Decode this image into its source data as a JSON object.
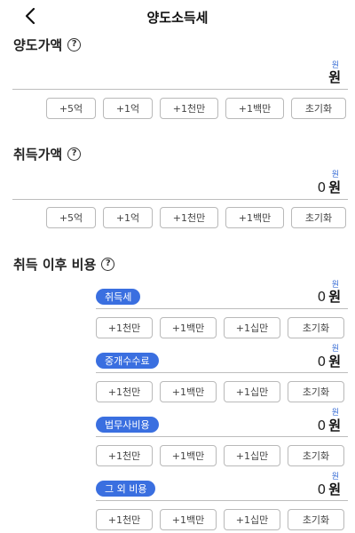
{
  "header": {
    "title": "양도소득세"
  },
  "sale": {
    "title": "양도가액",
    "help": "?",
    "unit_small": "원",
    "amount": "",
    "unit": "원",
    "buttons": [
      "+5억",
      "+1억",
      "+1천만",
      "+1백만",
      "초기화"
    ]
  },
  "acquisition": {
    "title": "취득가액",
    "help": "?",
    "unit_small": "원",
    "amount": "0",
    "unit": "원",
    "buttons": [
      "+5억",
      "+1억",
      "+1천만",
      "+1백만",
      "초기화"
    ]
  },
  "post_costs": {
    "title": "취득 이후 비용",
    "help": "?",
    "items": [
      {
        "label": "취득세",
        "unit_small": "원",
        "amount": "0",
        "unit": "원",
        "buttons": [
          "+1천만",
          "+1백만",
          "+1십만",
          "초기화"
        ]
      },
      {
        "label": "중개수수료",
        "unit_small": "원",
        "amount": "0",
        "unit": "원",
        "buttons": [
          "+1천만",
          "+1백만",
          "+1십만",
          "초기화"
        ]
      },
      {
        "label": "법무사비용",
        "unit_small": "원",
        "amount": "0",
        "unit": "원",
        "buttons": [
          "+1천만",
          "+1백만",
          "+1십만",
          "초기화"
        ]
      },
      {
        "label": "그 외 비용",
        "unit_small": "원",
        "amount": "0",
        "unit": "원",
        "buttons": [
          "+1천만",
          "+1백만",
          "+1십만",
          "초기화"
        ]
      }
    ]
  }
}
